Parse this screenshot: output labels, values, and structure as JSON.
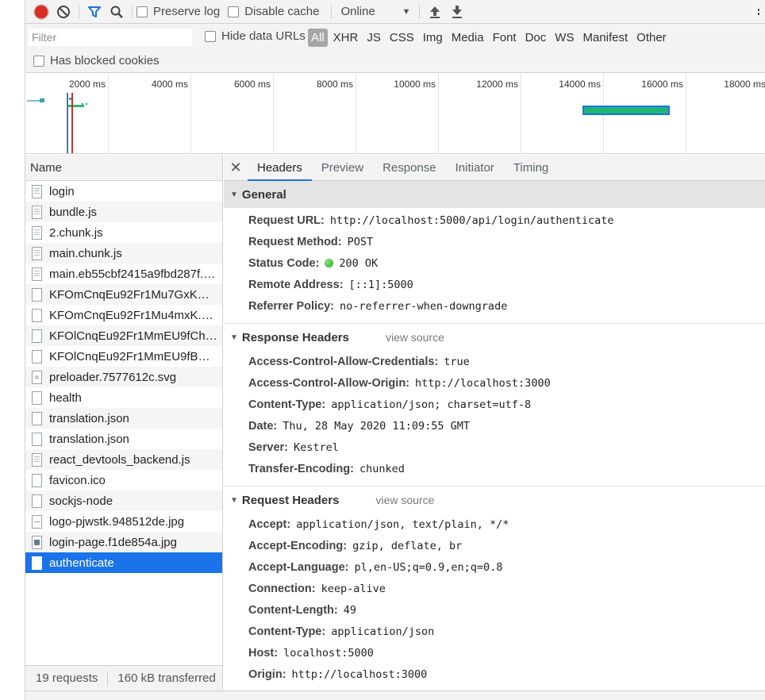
{
  "toolbar": {
    "preserve_log": "Preserve log",
    "disable_cache": "Disable cache",
    "throttling": "Online"
  },
  "filter": {
    "placeholder": "Filter",
    "hide_data_urls": "Hide data URLs",
    "types": [
      "All",
      "XHR",
      "JS",
      "CSS",
      "Img",
      "Media",
      "Font",
      "Doc",
      "WS",
      "Manifest",
      "Other"
    ],
    "has_blocked_cookies": "Has blocked cookies"
  },
  "overview": {
    "ticks": [
      "2000 ms",
      "4000 ms",
      "6000 ms",
      "8000 ms",
      "10000 ms",
      "12000 ms",
      "14000 ms",
      "16000 ms",
      "18000 ms"
    ]
  },
  "list": {
    "header": "Name",
    "rows": [
      {
        "name": "login",
        "icon": "doc"
      },
      {
        "name": "bundle.js",
        "icon": "doc"
      },
      {
        "name": "2.chunk.js",
        "icon": "doc"
      },
      {
        "name": "main.chunk.js",
        "icon": "doc"
      },
      {
        "name": "main.eb55cbf2415a9fbd287f.h...",
        "icon": "doc"
      },
      {
        "name": "KFOmCnqEu92Fr1Mu7GxKOz...",
        "icon": "blank"
      },
      {
        "name": "KFOmCnqEu92Fr1Mu4mxK.wo...",
        "icon": "blank"
      },
      {
        "name": "KFOlCnqEu92Fr1MmEU9fChc4...",
        "icon": "blank"
      },
      {
        "name": "KFOlCnqEu92Fr1MmEU9fBBc4...",
        "icon": "blank"
      },
      {
        "name": "preloader.7577612c.svg",
        "icon": "svg"
      },
      {
        "name": "health",
        "icon": "blank"
      },
      {
        "name": "translation.json",
        "icon": "blank"
      },
      {
        "name": "translation.json",
        "icon": "blank"
      },
      {
        "name": "react_devtools_backend.js",
        "icon": "doc"
      },
      {
        "name": "favicon.ico",
        "icon": "blank"
      },
      {
        "name": "sockjs-node",
        "icon": "blank"
      },
      {
        "name": "logo-pjwstk.948512de.jpg",
        "icon": "line"
      },
      {
        "name": "login-page.f1de854a.jpg",
        "icon": "img"
      },
      {
        "name": "authenticate",
        "icon": "blank",
        "selected": true
      }
    ],
    "summary_requests": "19 requests",
    "summary_transferred": "160 kB transferred"
  },
  "details": {
    "tabs": [
      "Headers",
      "Preview",
      "Response",
      "Initiator",
      "Timing"
    ],
    "active_tab": "Headers",
    "general": {
      "title": "General",
      "rows": [
        {
          "k": "Request URL:",
          "v": "http://localhost:5000/api/login/authenticate"
        },
        {
          "k": "Request Method:",
          "v": "POST"
        },
        {
          "k": "Status Code:",
          "v": "200 OK"
        },
        {
          "k": "Remote Address:",
          "v": "[::1]:5000"
        },
        {
          "k": "Referrer Policy:",
          "v": "no-referrer-when-downgrade"
        }
      ]
    },
    "response_headers": {
      "title": "Response Headers",
      "view_source": "view source",
      "rows": [
        {
          "k": "Access-Control-Allow-Credentials:",
          "v": "true"
        },
        {
          "k": "Access-Control-Allow-Origin:",
          "v": "http://localhost:3000"
        },
        {
          "k": "Content-Type:",
          "v": "application/json; charset=utf-8"
        },
        {
          "k": "Date:",
          "v": "Thu, 28 May 2020 11:09:55 GMT"
        },
        {
          "k": "Server:",
          "v": "Kestrel"
        },
        {
          "k": "Transfer-Encoding:",
          "v": "chunked"
        }
      ]
    },
    "request_headers": {
      "title": "Request Headers",
      "view_source": "view source",
      "rows": [
        {
          "k": "Accept:",
          "v": "application/json, text/plain, */*"
        },
        {
          "k": "Accept-Encoding:",
          "v": "gzip, deflate, br"
        },
        {
          "k": "Accept-Language:",
          "v": "pl,en-US;q=0.9,en;q=0.8"
        },
        {
          "k": "Connection:",
          "v": "keep-alive"
        },
        {
          "k": "Content-Length:",
          "v": "49"
        },
        {
          "k": "Content-Type:",
          "v": "application/json"
        },
        {
          "k": "Host:",
          "v": "localhost:5000"
        },
        {
          "k": "Origin:",
          "v": "http://localhost:3000"
        }
      ]
    }
  },
  "colors": {
    "record": "#d93025",
    "filter_active": "#1a73e8",
    "selected_row": "#1a73e8",
    "status_ok": "#22a122",
    "waterfall_bar": "#21b574"
  }
}
